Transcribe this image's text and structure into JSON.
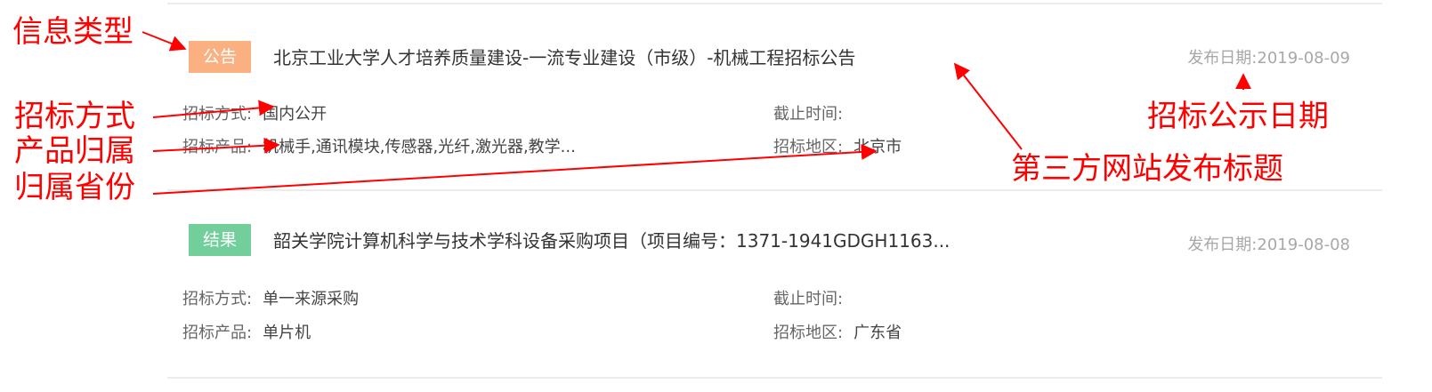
{
  "listing": [
    {
      "badge": "公告",
      "badge_color": "#fbb082",
      "title": "北京工业大学人才培养质量建设-一流专业建设（市级）-机械工程招标公告",
      "date_label": "发布日期:",
      "date": "2019-08-09",
      "method_label": "招标方式:",
      "method": "国内公开",
      "deadline_label": "截止时间:",
      "deadline": "",
      "product_label": "招标产品:",
      "product": "机械手,通讯模块,传感器,光纤,激光器,教学...",
      "region_label": "招标地区:",
      "region": "北京市"
    },
    {
      "badge": "结果",
      "badge_color": "#72cf9c",
      "title": "韶关学院计算机科学与技术学科设备采购项目（项目编号：1371-1941GDGH1163...",
      "date_label": "发布日期:",
      "date": "2019-08-08",
      "method_label": "招标方式:",
      "method": "单一来源采购",
      "deadline_label": "截止时间:",
      "deadline": "",
      "product_label": "招标产品:",
      "product": "单片机",
      "region_label": "招标地区:",
      "region": "广东省"
    }
  ],
  "annotations": {
    "info_type": "信息类型",
    "method": "招标方式",
    "product": "产品归属",
    "province": "归属省份",
    "publish_date": "招标公示日期",
    "third_party_title": "第三方网站发布标题",
    "color": "#ff0000"
  }
}
